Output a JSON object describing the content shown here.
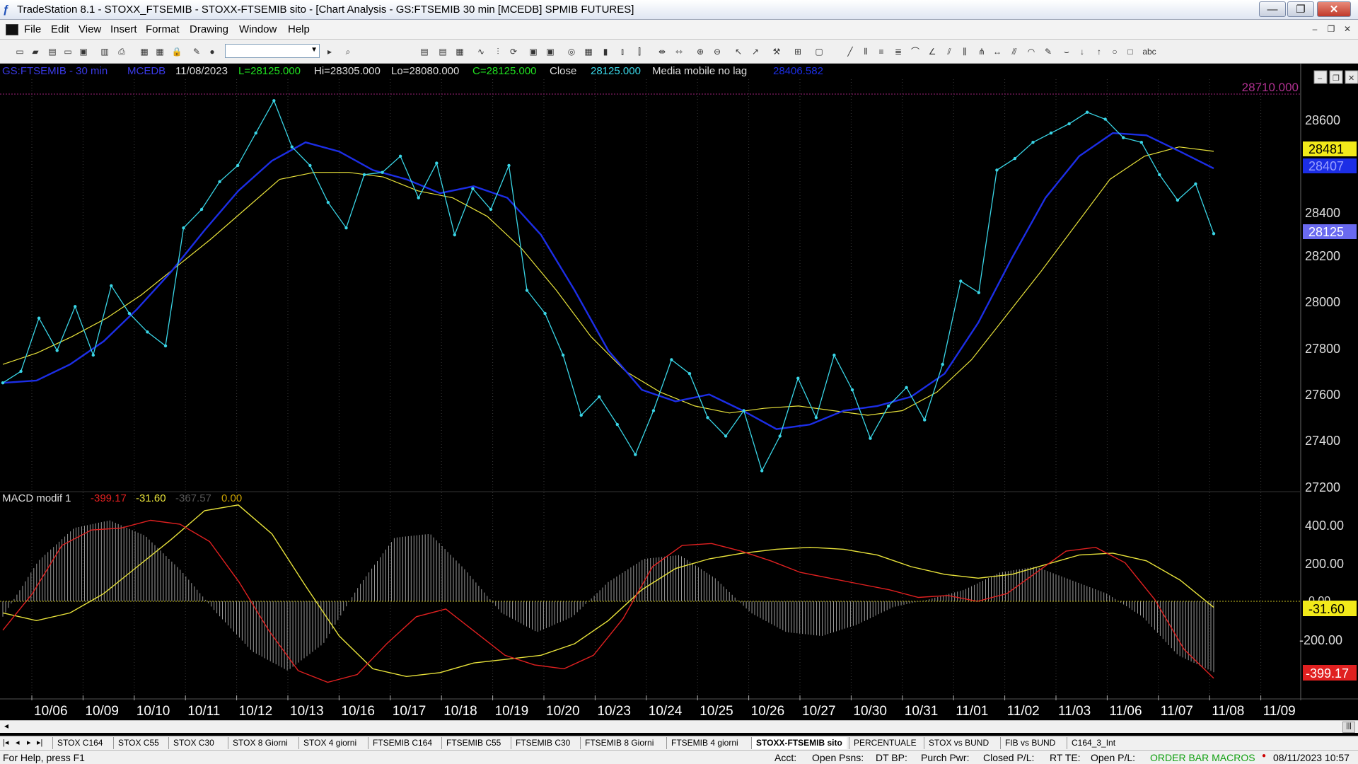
{
  "window": {
    "title": "TradeStation 8.1 - STOXX_FTSEMIB - STOXX-FTSEMIB sito - [Chart Analysis - GS:FTSEMIB  30 min  [MCEDB] SPMIB FUTURES]",
    "minimize": "—",
    "maximize": "❐",
    "close": "✕"
  },
  "menu": [
    "File",
    "Edit",
    "View",
    "Insert",
    "Format",
    "Drawing",
    "Window",
    "Help"
  ],
  "chart_header": {
    "symbol": "GS:FTSEMIB - 30 min",
    "exchange": "MCEDB",
    "date": "11/08/2023",
    "last": "L=28125.000",
    "high": "Hi=28305.000",
    "low": "Lo=28080.000",
    "close_val": "C=28125.000",
    "close_label": "Close",
    "close_num": "28125.000",
    "ma_label": "Media mobile no lag",
    "ma_value": "28406.582"
  },
  "macd_header": {
    "label": "MACD modif 1",
    "v1": "-399.17",
    "v2": "-31.60",
    "v3": "-367.57",
    "v4": "0.00"
  },
  "price_axis": {
    "hline_label": "28710.000",
    "ticks": [
      "28600",
      "28400",
      "28200",
      "28000",
      "27800",
      "27600",
      "27400",
      "27200"
    ],
    "tag_yellow": "28481",
    "tag_blue": "28407",
    "tag_last": "28125"
  },
  "macd_axis": {
    "ticks": [
      "400.00",
      "200.00",
      "-200.00"
    ],
    "tag_zero": "0.00",
    "tag_yellow": "-31.60",
    "tag_red": "-399.17"
  },
  "date_labels": [
    "10/06",
    "10/09",
    "10/10",
    "10/11",
    "10/12",
    "10/13",
    "10/16",
    "10/17",
    "10/18",
    "10/19",
    "10/20",
    "10/23",
    "10/24",
    "10/25",
    "10/26",
    "10/27",
    "10/30",
    "10/31",
    "11/01",
    "11/02",
    "11/03",
    "11/06",
    "11/07",
    "11/08",
    "11/09"
  ],
  "tabs": [
    "STOX C164",
    "STOX C55",
    "STOX  C30",
    "STOX  8 Giorni",
    "STOX 4 giorni",
    "FTSEMIB C164",
    "FTSEMIB C55",
    "FTSEMIB C30",
    "FTSEMIB  8 Giorni",
    "FTSEMIB  4 giorni",
    "STOXX-FTSEMIB sito",
    "PERCENTUALE",
    "STOX vs BUND",
    "FIB vs BUND",
    "C164_3_Int"
  ],
  "active_tab": "STOXX-FTSEMIB sito",
  "status": {
    "help": "For Help, press F1",
    "acct": "Acct:",
    "open_psns": "Open Psns:",
    "dt_bp": "DT BP:",
    "purch_pwr": "Purch Pwr:",
    "closed_pl": "Closed P/L:",
    "rt_te": "RT TE:",
    "open_pl": "Open P/L:",
    "macros": "ORDER BAR  MACROS",
    "datetime": "08/11/2023 10:57"
  },
  "colors": {
    "price": "#39d5e6",
    "ma_yellow": "#e8e23a",
    "ma_blue": "#1c2ee6",
    "macd_red": "#e02020",
    "macd_yellow": "#e8e23a",
    "hist": "#9a9a9a"
  },
  "chart_data": [
    {
      "type": "line",
      "title": "",
      "xlabel": "",
      "ylabel": "",
      "ylim": [
        27050,
        28760
      ],
      "x_labels": [
        "10/06",
        "10/09",
        "10/10",
        "10/11",
        "10/12",
        "10/13",
        "10/16",
        "10/17",
        "10/18",
        "10/19",
        "10/20",
        "10/23",
        "10/24",
        "10/25",
        "10/26",
        "10/27",
        "10/30",
        "10/31",
        "11/01",
        "11/02",
        "11/03",
        "11/06",
        "11/07",
        "11/08",
        "11/09"
      ],
      "series": [
        {
          "name": "Close",
          "values": [
            27480,
            27530,
            27760,
            27620,
            27810,
            27600,
            27900,
            27780,
            27700,
            27640,
            28150,
            28230,
            28350,
            28420,
            28560,
            28700,
            28500,
            28420,
            28260,
            28150,
            28380,
            28390,
            28460,
            28280,
            28430,
            28120,
            28320,
            28230,
            28420,
            27880,
            27780,
            27600,
            27340,
            27420,
            27300,
            27170,
            27360,
            27580,
            27520,
            27330,
            27250,
            27360,
            27100,
            27250,
            27500,
            27330,
            27600,
            27450,
            27240,
            27380,
            27460,
            27320,
            27560,
            27920,
            27870,
            28400,
            28450,
            28520,
            28560,
            28600,
            28650,
            28620,
            28540,
            28520,
            28380,
            28270,
            28340,
            28125
          ]
        },
        {
          "name": "Media mobile no lag",
          "values": [
            27560,
            27610,
            27680,
            27760,
            27860,
            27980,
            28100,
            28230,
            28360,
            28390,
            28390,
            28370,
            28310,
            28280,
            28200,
            28060,
            27880,
            27680,
            27530,
            27440,
            27380,
            27350,
            27370,
            27380,
            27360,
            27340,
            27360,
            27440,
            27580,
            27770,
            27960,
            28160,
            28360,
            28460,
            28500,
            28481
          ]
        },
        {
          "name": "",
          "values": [
            27480,
            27490,
            27560,
            27660,
            27800,
            27960,
            28140,
            28310,
            28440,
            28520,
            28480,
            28400,
            28360,
            28300,
            28330,
            28280,
            28120,
            27880,
            27620,
            27450,
            27400,
            27430,
            27360,
            27280,
            27300,
            27360,
            27380,
            27420,
            27520,
            27740,
            28020,
            28280,
            28460,
            28560,
            28550,
            28480,
            28407
          ]
        }
      ]
    },
    {
      "type": "line",
      "title": "",
      "ylim": [
        -520,
        520
      ],
      "series": [
        {
          "name": "",
          "values": [
            -150,
            40,
            290,
            370,
            380,
            420,
            400,
            310,
            100,
            -150,
            -360,
            -420,
            -380,
            -220,
            -80,
            -40,
            -160,
            -280,
            -330,
            -350,
            -280,
            -90,
            180,
            290,
            300,
            260,
            210,
            150,
            120,
            90,
            60,
            20,
            30,
            0,
            40,
            150,
            260,
            280,
            200,
            10,
            -250,
            -399.17
          ]
        },
        {
          "name": "",
          "values": [
            -60,
            -100,
            -60,
            40,
            180,
            320,
            470,
            500,
            350,
            80,
            -180,
            -350,
            -390,
            -370,
            -320,
            -300,
            -280,
            -220,
            -100,
            60,
            170,
            220,
            250,
            270,
            280,
            270,
            240,
            180,
            140,
            120,
            140,
            190,
            240,
            250,
            210,
            110,
            -31.6
          ]
        },
        {
          "name": "",
          "values": [
            -80,
            210,
            380,
            420,
            340,
            160,
            -60,
            -260,
            -360,
            -220,
            80,
            330,
            350,
            160,
            -60,
            -160,
            -80,
            100,
            220,
            240,
            120,
            -60,
            -160,
            -180,
            -120,
            -30,
            10,
            60,
            150,
            180,
            110,
            40,
            -80,
            -280,
            -367.57
          ]
        }
      ]
    }
  ]
}
